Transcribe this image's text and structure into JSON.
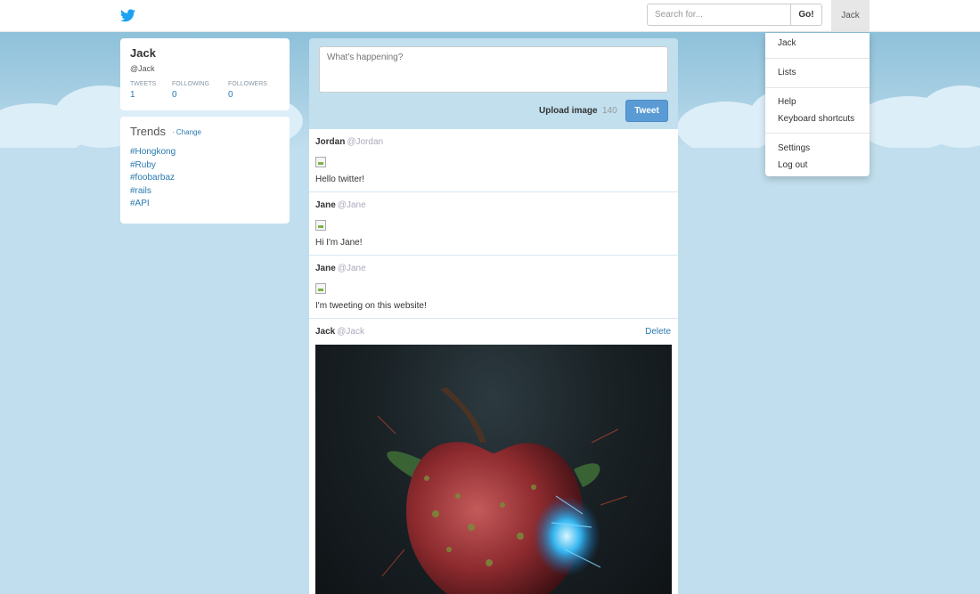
{
  "nav": {
    "search_placeholder": "Search for...",
    "search_button": "Go!",
    "user_label": "Jack",
    "dropdown": [
      "Jack",
      "Lists",
      "Help",
      "Keyboard shortcuts",
      "Settings",
      "Log out"
    ]
  },
  "profile": {
    "name": "Jack",
    "handle": "@Jack",
    "stats": [
      {
        "label": "TWEETS",
        "value": "1"
      },
      {
        "label": "FOLLOWING",
        "value": "0"
      },
      {
        "label": "FOLLOWERS",
        "value": "0"
      }
    ]
  },
  "trends": {
    "title": "Trends",
    "change_label": "Change",
    "items": [
      "#Hongkong",
      "#Ruby",
      "#foobarbaz",
      "#rails",
      "#API"
    ]
  },
  "composer": {
    "placeholder": "What's happening?",
    "upload_label": "Upload image",
    "char_count": "140",
    "tweet_button": "Tweet"
  },
  "tweets": [
    {
      "name": "Jordan",
      "handle": "@Jordan",
      "text": "Hello twitter!"
    },
    {
      "name": "Jane",
      "handle": "@Jane",
      "text": "Hi I'm Jane!"
    },
    {
      "name": "Jane",
      "handle": "@Jane",
      "text": "I'm tweeting on this website!"
    },
    {
      "name": "Jack",
      "handle": "@Jack",
      "delete_label": "Delete"
    }
  ],
  "colors": {
    "link": "#2a7ab0",
    "tweet_button": "#5b9bd5",
    "twitter_blue": "#1da1f2",
    "background": "#c0deed"
  }
}
